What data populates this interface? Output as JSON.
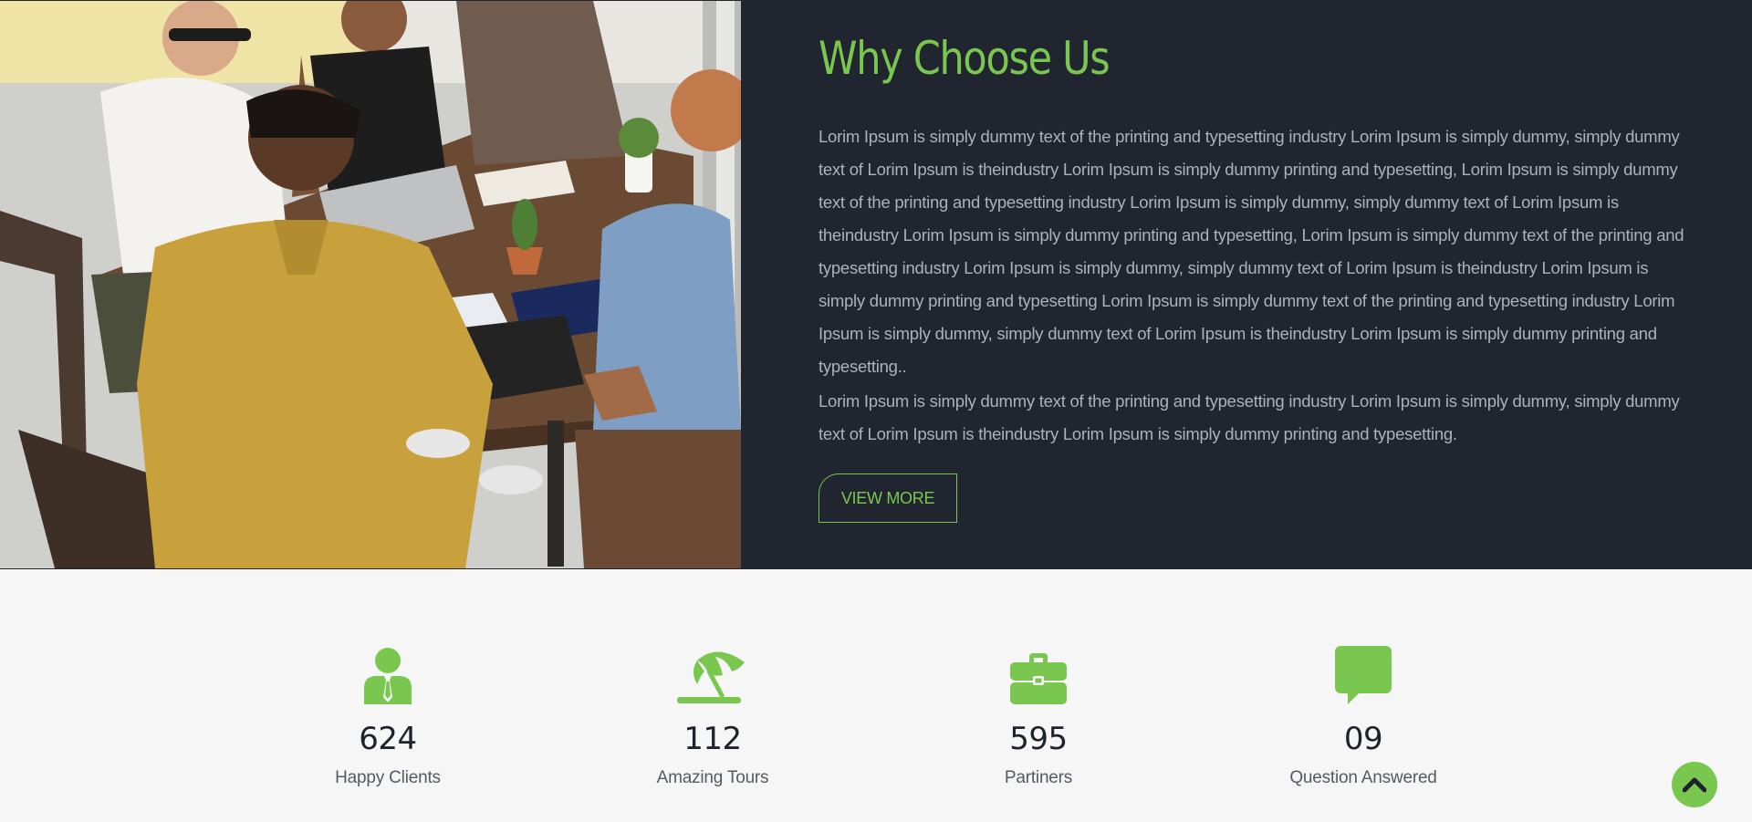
{
  "why": {
    "title": "Why Choose Us",
    "paragraph_1": "Lorim Ipsum is simply dummy text of the printing and typesetting industry Lorim Ipsum is simply dummy, simply dummy text of Lorim Ipsum is theindustry Lorim Ipsum is simply dummy printing and typesetting, Lorim Ipsum is simply dummy text of the printing and typesetting industry Lorim Ipsum is simply dummy, simply dummy text of Lorim Ipsum is theindustry Lorim Ipsum is simply dummy printing and typesetting, Lorim Ipsum is simply dummy text of the printing and typesetting industry Lorim Ipsum is simply dummy, simply dummy text of Lorim Ipsum is theindustry Lorim Ipsum is simply dummy printing and typesetting Lorim Ipsum is simply dummy text of the printing and typesetting industry Lorim Ipsum is simply dummy, simply dummy text of Lorim Ipsum is theindustry Lorim Ipsum is simply dummy printing and typesetting..",
    "paragraph_2": "Lorim Ipsum is simply dummy text of the printing and typesetting industry Lorim Ipsum is simply dummy, simply dummy text of Lorim Ipsum is theindustry Lorim Ipsum is simply dummy printing and typesetting.",
    "button_label": "VIEW MORE"
  },
  "stats": [
    {
      "icon": "person-icon",
      "number": "624",
      "label": "Happy Clients"
    },
    {
      "icon": "beach-umbrella-icon",
      "number": "112",
      "label": "Amazing Tours"
    },
    {
      "icon": "briefcase-icon",
      "number": "595",
      "label": "Partiners"
    },
    {
      "icon": "speech-bubble-icon",
      "number": "09",
      "label": "Question Answered"
    }
  ],
  "scroll_top": {
    "icon": "chevron-up-icon"
  },
  "colors": {
    "accent": "#7ac74f",
    "dark_bg": "#212530",
    "light_bg": "#f6f6f6",
    "body_text": "#aeb1b9"
  }
}
